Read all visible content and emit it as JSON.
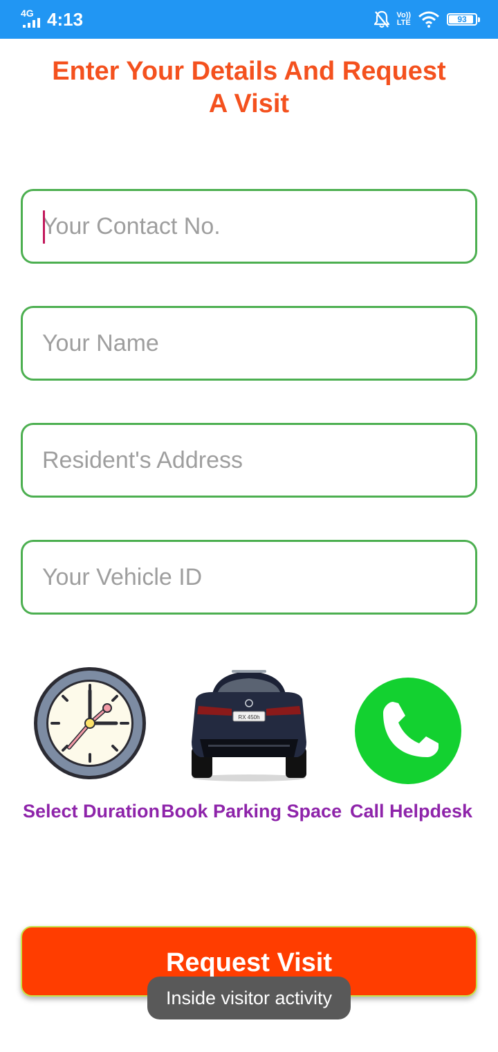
{
  "status_bar": {
    "network": "4G",
    "time": "4:13",
    "volte_top": "Vo))",
    "volte_bottom": "LTE",
    "battery_level": "93",
    "icons": [
      "signal-icon",
      "mute-icon",
      "volte-icon",
      "wifi-icon",
      "battery-icon"
    ]
  },
  "title": {
    "line1": "Enter Your Details And Request",
    "line2": "A Visit"
  },
  "form": {
    "contact_placeholder": "Your Contact No.",
    "name_placeholder": "Your Name",
    "address_placeholder": "Resident's Address",
    "vehicle_placeholder": "Your Vehicle ID"
  },
  "options": {
    "duration_label": "Select Duration",
    "parking_label": "Book Parking Space",
    "helpdesk_label": "Call Helpdesk",
    "car_plate": "RX 450h",
    "icons": [
      "clock-icon",
      "car-icon",
      "phone-icon"
    ]
  },
  "request_button": "Request Visit",
  "toast": "Inside visitor activity",
  "colors": {
    "status_bar": "#2196f3",
    "title": "#f4511e",
    "field_border": "#4caf50",
    "option_label": "#8e24aa",
    "button": "#ff3d00",
    "helpdesk_green": "#13d130"
  }
}
